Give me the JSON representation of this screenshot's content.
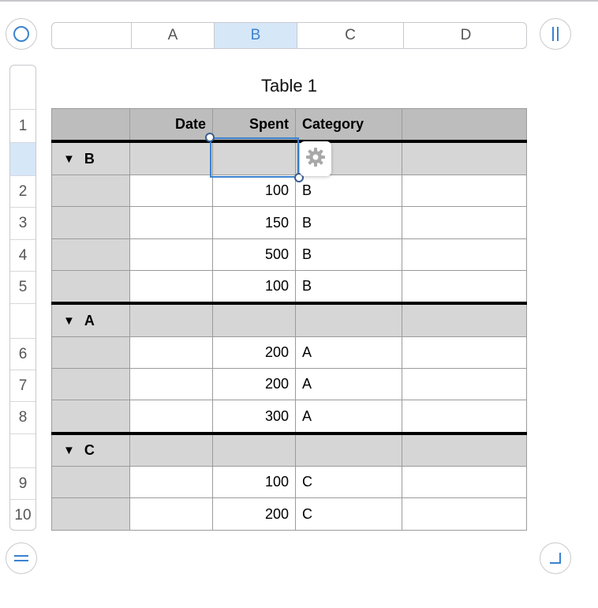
{
  "columns": {
    "blank": "",
    "headers": [
      {
        "label": "A",
        "selected": false
      },
      {
        "label": "B",
        "selected": true
      },
      {
        "label": "C",
        "selected": false
      },
      {
        "label": "D",
        "selected": false
      }
    ]
  },
  "rows": {
    "labels": [
      "",
      "1",
      "",
      "2",
      "3",
      "4",
      "5",
      "",
      "6",
      "7",
      "8",
      "",
      "9",
      "10"
    ],
    "selected_index": 2
  },
  "table": {
    "title": "Table 1",
    "header": [
      "",
      "Date",
      "Spent",
      "Category",
      ""
    ],
    "groups": [
      {
        "name": "B",
        "triangle": "▼",
        "rows": [
          {
            "date": "",
            "spent": "100",
            "category": "B"
          },
          {
            "date": "",
            "spent": "150",
            "category": "B"
          },
          {
            "date": "",
            "spent": "500",
            "category": "B"
          },
          {
            "date": "",
            "spent": "100",
            "category": "B"
          }
        ]
      },
      {
        "name": "A",
        "triangle": "▼",
        "rows": [
          {
            "date": "",
            "spent": "200",
            "category": "A"
          },
          {
            "date": "",
            "spent": "200",
            "category": "A"
          },
          {
            "date": "",
            "spent": "300",
            "category": "A"
          }
        ]
      },
      {
        "name": "C",
        "triangle": "▼",
        "rows": [
          {
            "date": "",
            "spent": "100",
            "category": "C"
          },
          {
            "date": "",
            "spent": "200",
            "category": "C"
          }
        ]
      }
    ]
  },
  "icons": {
    "top_left": "circle-icon",
    "top_right": "column-resize-icon",
    "bottom_left": "row-resize-icon",
    "bottom_right": "corner-resize-icon",
    "cell_action": "gear-icon"
  },
  "colors": {
    "accent": "#3b82d0",
    "selection_fill": "#d6e7f8",
    "header_fill": "#bdbdbd",
    "group_fill": "#d6d6d6"
  }
}
